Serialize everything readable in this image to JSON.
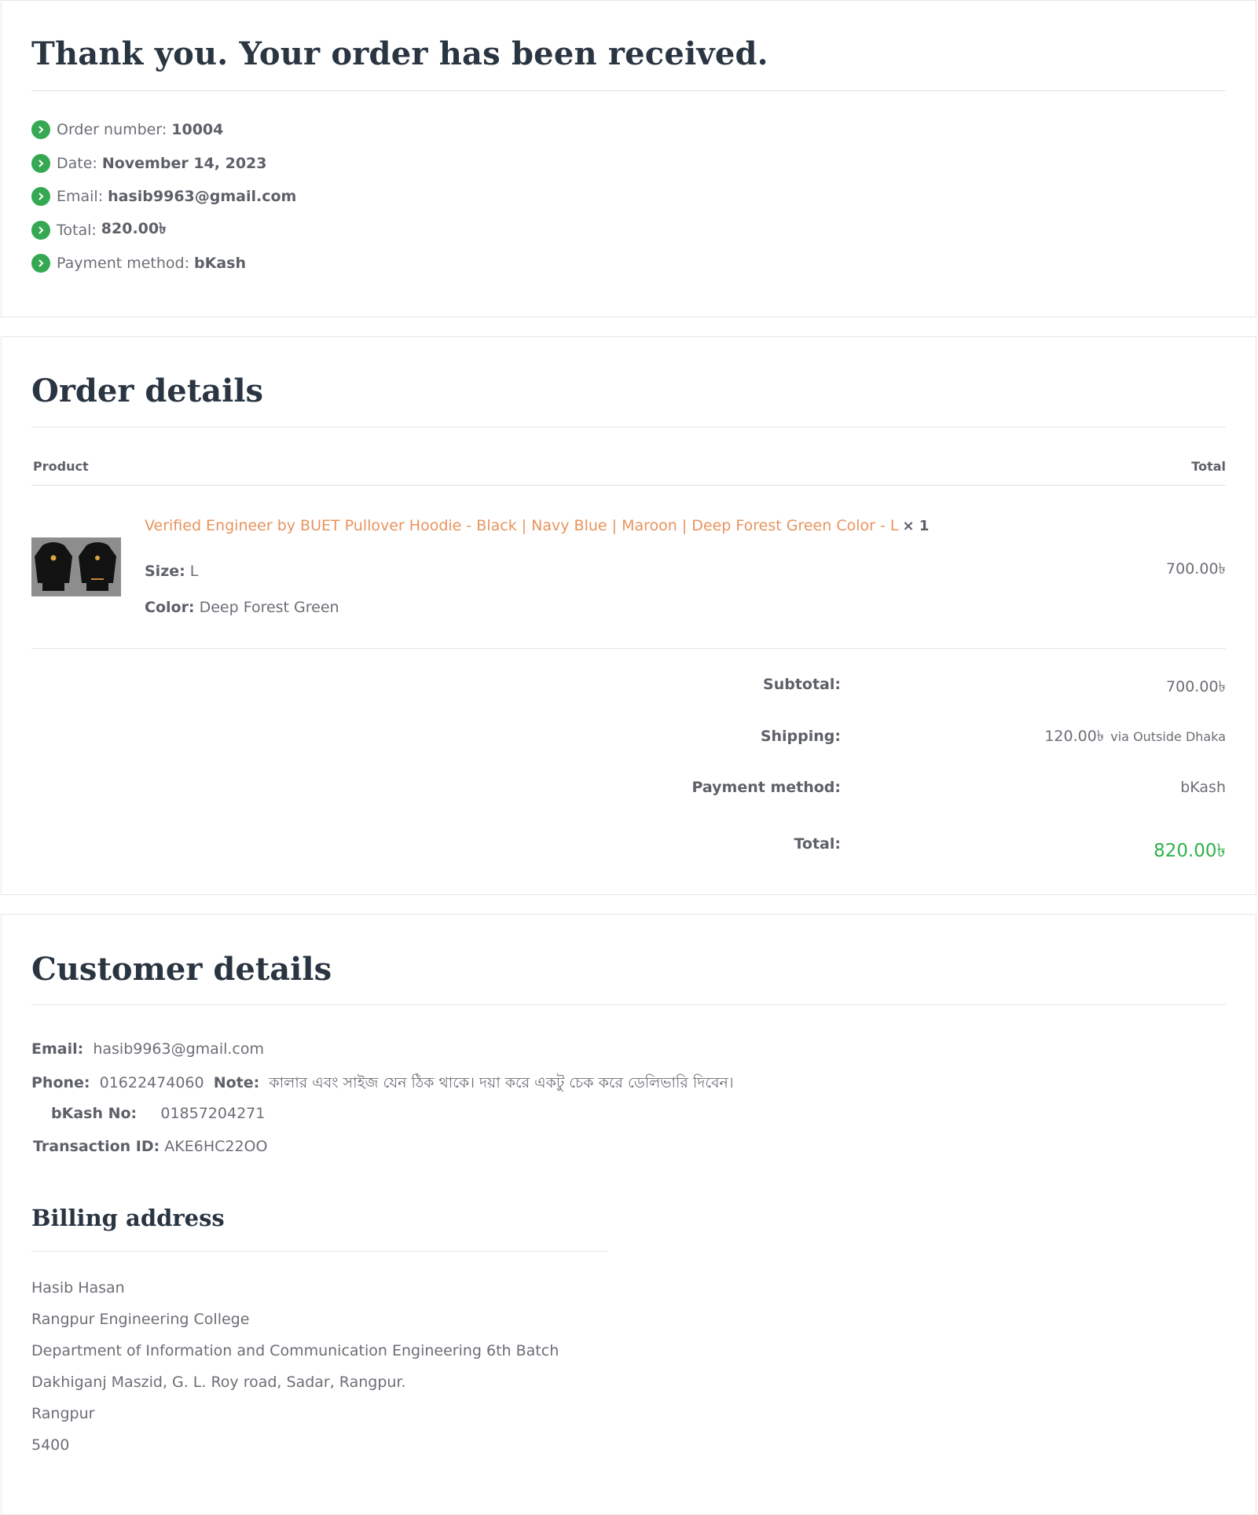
{
  "overview": {
    "title": "Thank you. Your order has been received.",
    "items": [
      {
        "label": "Order number:",
        "value": "10004"
      },
      {
        "label": "Date:",
        "value": "November 14, 2023"
      },
      {
        "label": "Email:",
        "value": "hasib9963@gmail.com"
      },
      {
        "label": "Total:",
        "value": "820.00৳"
      },
      {
        "label": "Payment method:",
        "value": "bKash"
      }
    ]
  },
  "order": {
    "title": "Order details",
    "headers": {
      "product": "Product",
      "total": "Total"
    },
    "item": {
      "name": "Verified Engineer by BUET Pullover Hoodie - Black | Navy Blue | Maroon | Deep Forest Green Color - L",
      "qty": "× 1",
      "size_label": "Size:",
      "size": "L",
      "color_label": "Color:",
      "color": "Deep Forest Green",
      "total": "700.00৳"
    },
    "totals": {
      "subtotal_label": "Subtotal:",
      "subtotal": "700.00৳",
      "shipping_label": "Shipping:",
      "shipping": "120.00৳",
      "shipping_via": "via Outside Dhaka",
      "payment_label": "Payment method:",
      "payment": "bKash",
      "total_label": "Total:",
      "total": "820.00৳"
    }
  },
  "customer": {
    "title": "Customer details",
    "email_label": "Email:",
    "email": "hasib9963@gmail.com",
    "phone_label": "Phone:",
    "phone": "01622474060",
    "note_label": "Note:",
    "note": "কালার এবং সাইজ যেন ঠিক থাকে। দয়া করে একটু চেক করে ডেলিভারি দিবেন।",
    "bkash_label": "bKash No:",
    "bkash": "01857204271",
    "trx_label": "Transaction ID:",
    "trx": "AKE6HC22OO"
  },
  "billing": {
    "title": "Billing address",
    "lines": [
      "Hasib Hasan",
      "Rangpur Engineering College",
      "Department of Information and Communication Engineering 6th Batch",
      "Dakhiganj Maszid, G. L. Roy road, Sadar, Rangpur.",
      "Rangpur",
      "5400"
    ]
  },
  "colors": {
    "accent_green": "#34a853",
    "link_orange": "#e8945e",
    "heading": "#2a3542"
  }
}
